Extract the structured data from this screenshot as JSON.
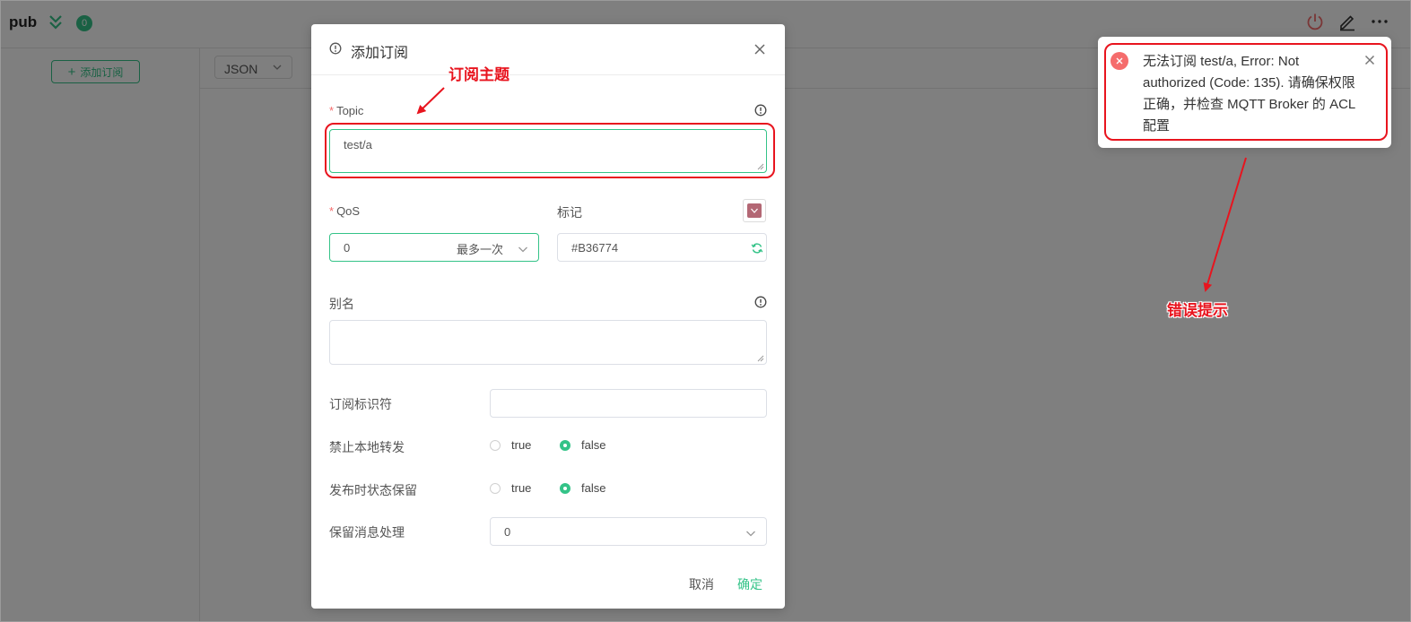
{
  "app": {
    "connection_name": "pub",
    "message_count": "0",
    "add_subscription_label": "添加订阅",
    "payload_format": "JSON"
  },
  "dialog": {
    "title": "添加订阅",
    "topic": {
      "label": "Topic",
      "value": "test/a"
    },
    "qos": {
      "label": "QoS",
      "value": "0",
      "description": "最多一次"
    },
    "color": {
      "label": "标记",
      "value": "#B36774",
      "swatch": "#B36774"
    },
    "alias": {
      "label": "别名",
      "value": ""
    },
    "subscription_identifier": {
      "label": "订阅标识符",
      "value": ""
    },
    "no_local": {
      "label": "禁止本地转发",
      "options": [
        "true",
        "false"
      ],
      "selected": "false"
    },
    "retain_as_published": {
      "label": "发布时状态保留",
      "options": [
        "true",
        "false"
      ],
      "selected": "false"
    },
    "retain_handling": {
      "label": "保留消息处理",
      "value": "0"
    },
    "cancel_label": "取消",
    "confirm_label": "确定"
  },
  "notification": {
    "type": "error",
    "message": "无法订阅 test/a, Error: Not authorized (Code: 135). 请确保权限正确，并检查 MQTT Broker 的 ACL 配置"
  },
  "annotations": {
    "topic_note": "订阅主题",
    "error_note": "错误提示"
  },
  "colors": {
    "accent": "#34c388",
    "error": "#f56c6c",
    "annotation": "#e8141e"
  }
}
